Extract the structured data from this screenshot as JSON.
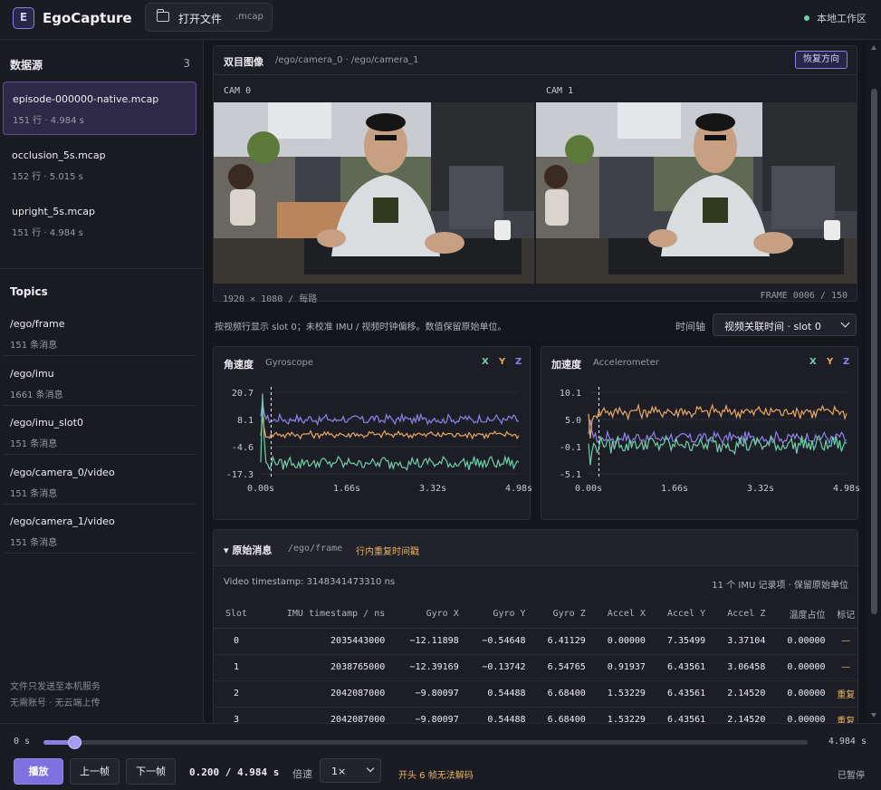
{
  "app": {
    "logo_letter": "E",
    "title": "EgoCapture",
    "open_file": "打开文件",
    "open_ext": ".mcap",
    "workspace": "本地工作区"
  },
  "sidebar": {
    "sources_title": "数据源",
    "sources_count": "3",
    "sources": [
      {
        "name": "episode-000000-native.mcap",
        "meta": "151 行 · 4.984 s",
        "active": true
      },
      {
        "name": "occlusion_5s.mcap",
        "meta": "152 行 · 5.015 s",
        "active": false
      },
      {
        "name": "upright_5s.mcap",
        "meta": "151 行 · 4.984 s",
        "active": false
      }
    ],
    "topics_title": "Topics",
    "topics": [
      {
        "name": "/ego/frame",
        "meta": "151 条消息"
      },
      {
        "name": "/ego/imu",
        "meta": "1661 条消息"
      },
      {
        "name": "/ego/imu_slot0",
        "meta": "151 条消息"
      },
      {
        "name": "/ego/camera_0/video",
        "meta": "151 条消息"
      },
      {
        "name": "/ego/camera_1/video",
        "meta": "151 条消息"
      }
    ],
    "note_line1": "文件只发送至本机服务",
    "note_line2": "无需账号 · 无云端上传"
  },
  "camera": {
    "title": "双目图像",
    "subtitle": "/ego/camera_0 · /ego/camera_1",
    "restore_btn": "恢复方向",
    "cam0_label": "CAM 0",
    "cam1_label": "CAM 1",
    "resolution": "1920 × 1080 / 每路",
    "frame": "FRAME 0006 / 150"
  },
  "hint": "按视频行显示 slot 0；未校准 IMU / 视频时钟偏移。数值保留原始单位。",
  "axis": {
    "label": "时间轴",
    "selected": "视频关联时间 · slot 0"
  },
  "legend": {
    "x": "X",
    "y": "Y",
    "z": "Z"
  },
  "colors": {
    "accent": "#8b7fe6",
    "x": "#8e82ea",
    "y": "#e7a865",
    "z": "#6fd0a8",
    "warn": "#e6b45e"
  },
  "chart_data": [
    {
      "type": "line",
      "title": "角速度",
      "subtitle": "Gyroscope",
      "yticks": [
        "20.7",
        "8.1",
        "-4.6",
        "-17.3"
      ],
      "xticks": [
        "0.00s",
        "1.66s",
        "3.32s",
        "4.98s"
      ],
      "ylim": [
        -17.3,
        20.7
      ],
      "xlim": [
        0,
        4.98
      ],
      "cursor_x": 0.2,
      "series": [
        {
          "name": "X",
          "base": 8.1,
          "amp": 1.8,
          "spike": 16.5
        },
        {
          "name": "Y",
          "base": 1.0,
          "amp": 1.4,
          "spike": 9.0
        },
        {
          "name": "Z",
          "base": -12.2,
          "amp": 2.4,
          "spike": 20.0
        }
      ]
    },
    {
      "type": "line",
      "title": "加速度",
      "subtitle": "Accelerometer",
      "yticks": [
        "10.1",
        "5.0",
        "-0.1",
        "-5.1"
      ],
      "xticks": [
        "0.00s",
        "1.66s",
        "3.32s",
        "4.98s"
      ],
      "ylim": [
        -5.1,
        10.1
      ],
      "xlim": [
        0,
        4.98
      ],
      "cursor_x": 0.2,
      "series": [
        {
          "name": "X",
          "base": 1.6,
          "amp": 0.9,
          "spike": 5.0
        },
        {
          "name": "Y",
          "base": 6.5,
          "amp": 1.0,
          "spike": 1.5
        },
        {
          "name": "Z",
          "base": 0.4,
          "amp": 1.3,
          "spike": -3.5
        }
      ]
    }
  ],
  "raw": {
    "title": "▾ 原始消息",
    "path": "/ego/frame",
    "warn": "行内重复时间戳",
    "video_ts": "Video timestamp: 3148341473310 ns",
    "info": "11 个 IMU 记录项 · 保留原始单位",
    "headers": [
      "Slot",
      "IMU timestamp / ns",
      "Gyro X",
      "Gyro Y",
      "Gyro Z",
      "Accel X",
      "Accel Y",
      "Accel Z",
      "温度占位",
      "标记"
    ],
    "rows": [
      [
        "0",
        "2035443000",
        "−12.11898",
        "−0.54648",
        "6.41129",
        "0.00000",
        "7.35499",
        "3.37104",
        "0.00000",
        "—"
      ],
      [
        "1",
        "2038765000",
        "−12.39169",
        "−0.13742",
        "6.54765",
        "0.91937",
        "6.43561",
        "3.06458",
        "0.00000",
        "—"
      ],
      [
        "2",
        "2042087000",
        "−9.80097",
        "0.54488",
        "6.68400",
        "1.53229",
        "6.43561",
        "2.14520",
        "0.00000",
        "重复"
      ],
      [
        "3",
        "2042087000",
        "−9.80097",
        "0.54488",
        "6.68400",
        "1.53229",
        "6.43561",
        "2.14520",
        "0.00000",
        "重复"
      ]
    ]
  },
  "player": {
    "start": "0 s",
    "end": "4.984 s",
    "progress": 0.0401,
    "play": "播放",
    "prev": "上一帧",
    "next": "下一帧",
    "current": "0.200 / 4.984 s",
    "speed_label": "倍速",
    "speed": "1×",
    "decode_warn": "开头 6 帧无法解码",
    "state": "已暂停"
  }
}
